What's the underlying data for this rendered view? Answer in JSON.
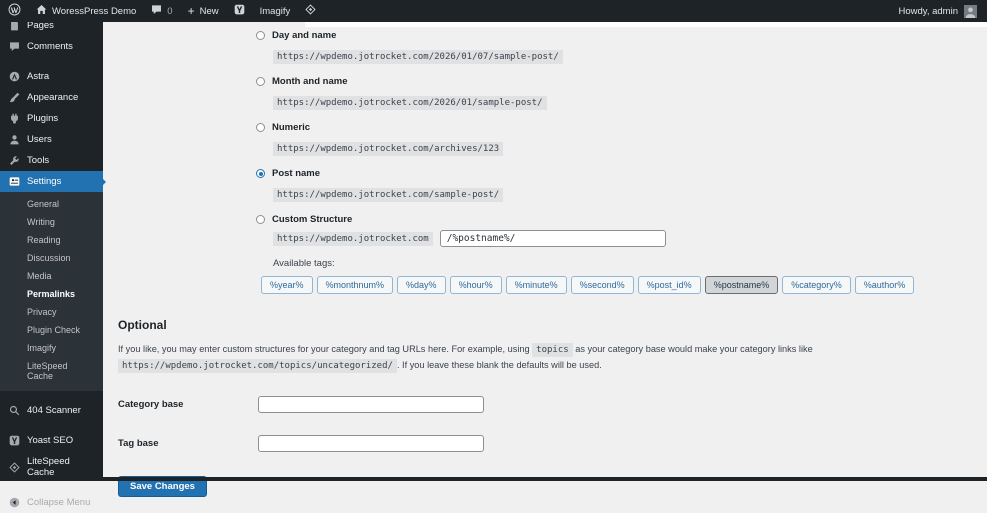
{
  "admin_bar": {
    "site_name": "WoressPress Demo",
    "comments_count": "0",
    "new_label": "New",
    "imagify_label": "Imagify",
    "howdy": "Howdy, admin",
    "icons": [
      "wordpress-logo",
      "home",
      "comment",
      "plus",
      "yoast",
      "litespeed",
      "avatar"
    ]
  },
  "sidebar": {
    "clipped_item": {
      "label": "Pages",
      "icon": "pages"
    },
    "items": [
      {
        "label": "Comments",
        "icon": "comments"
      },
      {
        "label": "Astra",
        "icon": "astra",
        "gap_before": true
      },
      {
        "label": "Appearance",
        "icon": "appearance"
      },
      {
        "label": "Plugins",
        "icon": "plugins"
      },
      {
        "label": "Users",
        "icon": "users"
      },
      {
        "label": "Tools",
        "icon": "tools"
      },
      {
        "label": "Settings",
        "icon": "settings",
        "active": true
      }
    ],
    "settings_submenu": [
      "General",
      "Writing",
      "Reading",
      "Discussion",
      "Media",
      "Permalinks",
      "Privacy",
      "Plugin Check",
      "Imagify",
      "LiteSpeed Cache"
    ],
    "submenu_active": "Permalinks",
    "items_after": [
      {
        "label": "404 Scanner",
        "icon": "search",
        "gap_before": true
      },
      {
        "label": "Yoast SEO",
        "icon": "yoast",
        "gap_before": true
      },
      {
        "label": "LiteSpeed Cache",
        "icon": "litespeed"
      },
      {
        "label": "Collapse Menu",
        "icon": "collapse",
        "muted": true,
        "gap_before": true
      }
    ]
  },
  "main": {
    "options": [
      {
        "label": "Day and name",
        "example": "https://wpdemo.jotrocket.com/2026/01/07/sample-post/",
        "selected": false
      },
      {
        "label": "Month and name",
        "example": "https://wpdemo.jotrocket.com/2026/01/sample-post/",
        "selected": false
      },
      {
        "label": "Numeric",
        "example": "https://wpdemo.jotrocket.com/archives/123",
        "selected": false
      },
      {
        "label": "Post name",
        "example": "https://wpdemo.jotrocket.com/sample-post/",
        "selected": true
      }
    ],
    "custom": {
      "label": "Custom Structure",
      "selected": false,
      "prefix": "https://wpdemo.jotrocket.com",
      "value": "/%postname%/"
    },
    "available_tags_label": "Available tags:",
    "tags": [
      "%year%",
      "%monthnum%",
      "%day%",
      "%hour%",
      "%minute%",
      "%second%",
      "%post_id%",
      "%postname%",
      "%category%",
      "%author%"
    ],
    "active_tag": "%postname%",
    "optional": {
      "title": "Optional",
      "desc_part1": "If you like, you may enter custom structures for your category and tag URLs here. For example, using",
      "desc_code1": "topics",
      "desc_part2": "as your category base would make your category links like",
      "desc_code2": "https://wpdemo.jotrocket.com/topics/uncategorized/",
      "desc_part3": ". If you leave these blank the defaults will be used.",
      "fields": [
        {
          "label": "Category base",
          "value": ""
        },
        {
          "label": "Tag base",
          "value": ""
        }
      ],
      "save_label": "Save Changes"
    }
  },
  "colors": {
    "accent": "#2271b1",
    "admin_dark": "#1d2327",
    "submenu_dark": "#2c3338",
    "content_bg": "#f0f0f1",
    "code_bg": "#e0e1e3",
    "sidebar_icon": "#a7aaad"
  }
}
